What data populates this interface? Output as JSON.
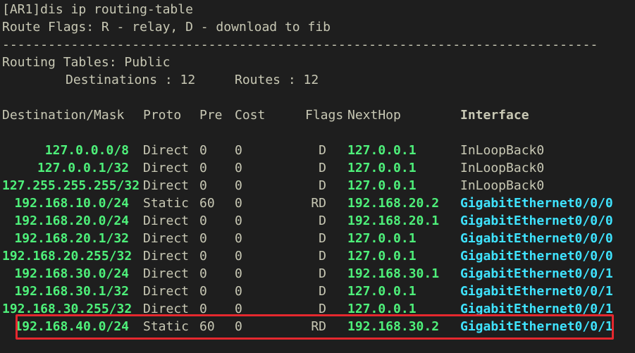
{
  "terminal": {
    "prompt": "[AR1]dis ip routing-table",
    "route_flags": "Route Flags: R - relay, D - download to fib",
    "separator": "------------------------------------------------------------------------------",
    "routing_tables": "Routing Tables: Public",
    "destinations_label": "Destinations : 12",
    "routes_label": "Routes : 12"
  },
  "columns": {
    "destination": "Destination/Mask",
    "proto": "Proto",
    "pre": "Pre",
    "cost": "Cost",
    "flags": "Flags",
    "nexthop": "NextHop",
    "interface": "Interface"
  },
  "routes": [
    {
      "dest": "127.0.0.0/8",
      "proto": "Direct",
      "pre": "0",
      "cost": "0",
      "flags": "D",
      "nexthop": "127.0.0.1",
      "iface": "InLoopBack0"
    },
    {
      "dest": "127.0.0.1/32",
      "proto": "Direct",
      "pre": "0",
      "cost": "0",
      "flags": "D",
      "nexthop": "127.0.0.1",
      "iface": "InLoopBack0"
    },
    {
      "dest": "127.255.255.255/32",
      "proto": "Direct",
      "pre": "0",
      "cost": "0",
      "flags": "D",
      "nexthop": "127.0.0.1",
      "iface": "InLoopBack0"
    },
    {
      "dest": "192.168.10.0/24",
      "proto": "Static",
      "pre": "60",
      "cost": "0",
      "flags": "RD",
      "nexthop": "192.168.20.2",
      "iface": "GigabitEthernet0/0/0"
    },
    {
      "dest": "192.168.20.0/24",
      "proto": "Direct",
      "pre": "0",
      "cost": "0",
      "flags": "D",
      "nexthop": "192.168.20.1",
      "iface": "GigabitEthernet0/0/0"
    },
    {
      "dest": "192.168.20.1/32",
      "proto": "Direct",
      "pre": "0",
      "cost": "0",
      "flags": "D",
      "nexthop": "127.0.0.1",
      "iface": "GigabitEthernet0/0/0"
    },
    {
      "dest": "192.168.20.255/32",
      "proto": "Direct",
      "pre": "0",
      "cost": "0",
      "flags": "D",
      "nexthop": "127.0.0.1",
      "iface": "GigabitEthernet0/0/0"
    },
    {
      "dest": "192.168.30.0/24",
      "proto": "Direct",
      "pre": "0",
      "cost": "0",
      "flags": "D",
      "nexthop": "192.168.30.1",
      "iface": "GigabitEthernet0/0/1"
    },
    {
      "dest": "192.168.30.1/32",
      "proto": "Direct",
      "pre": "0",
      "cost": "0",
      "flags": "D",
      "nexthop": "127.0.0.1",
      "iface": "GigabitEthernet0/0/1"
    },
    {
      "dest": "192.168.30.255/32",
      "proto": "Direct",
      "pre": "0",
      "cost": "0",
      "flags": "D",
      "nexthop": "127.0.0.1",
      "iface": "GigabitEthernet0/0/1"
    },
    {
      "dest": "192.168.40.0/24",
      "proto": "Static",
      "pre": "60",
      "cost": "0",
      "flags": "RD",
      "nexthop": "192.168.30.2",
      "iface": "GigabitEthernet0/0/1"
    }
  ],
  "colors": {
    "background": "#1e1e1e",
    "text": "#c8c8b4",
    "destination": "#4ef07a",
    "interface_gigabit": "#3fe3ff",
    "interface_header": "#ffae3d",
    "highlight_border": "#e5282e"
  }
}
